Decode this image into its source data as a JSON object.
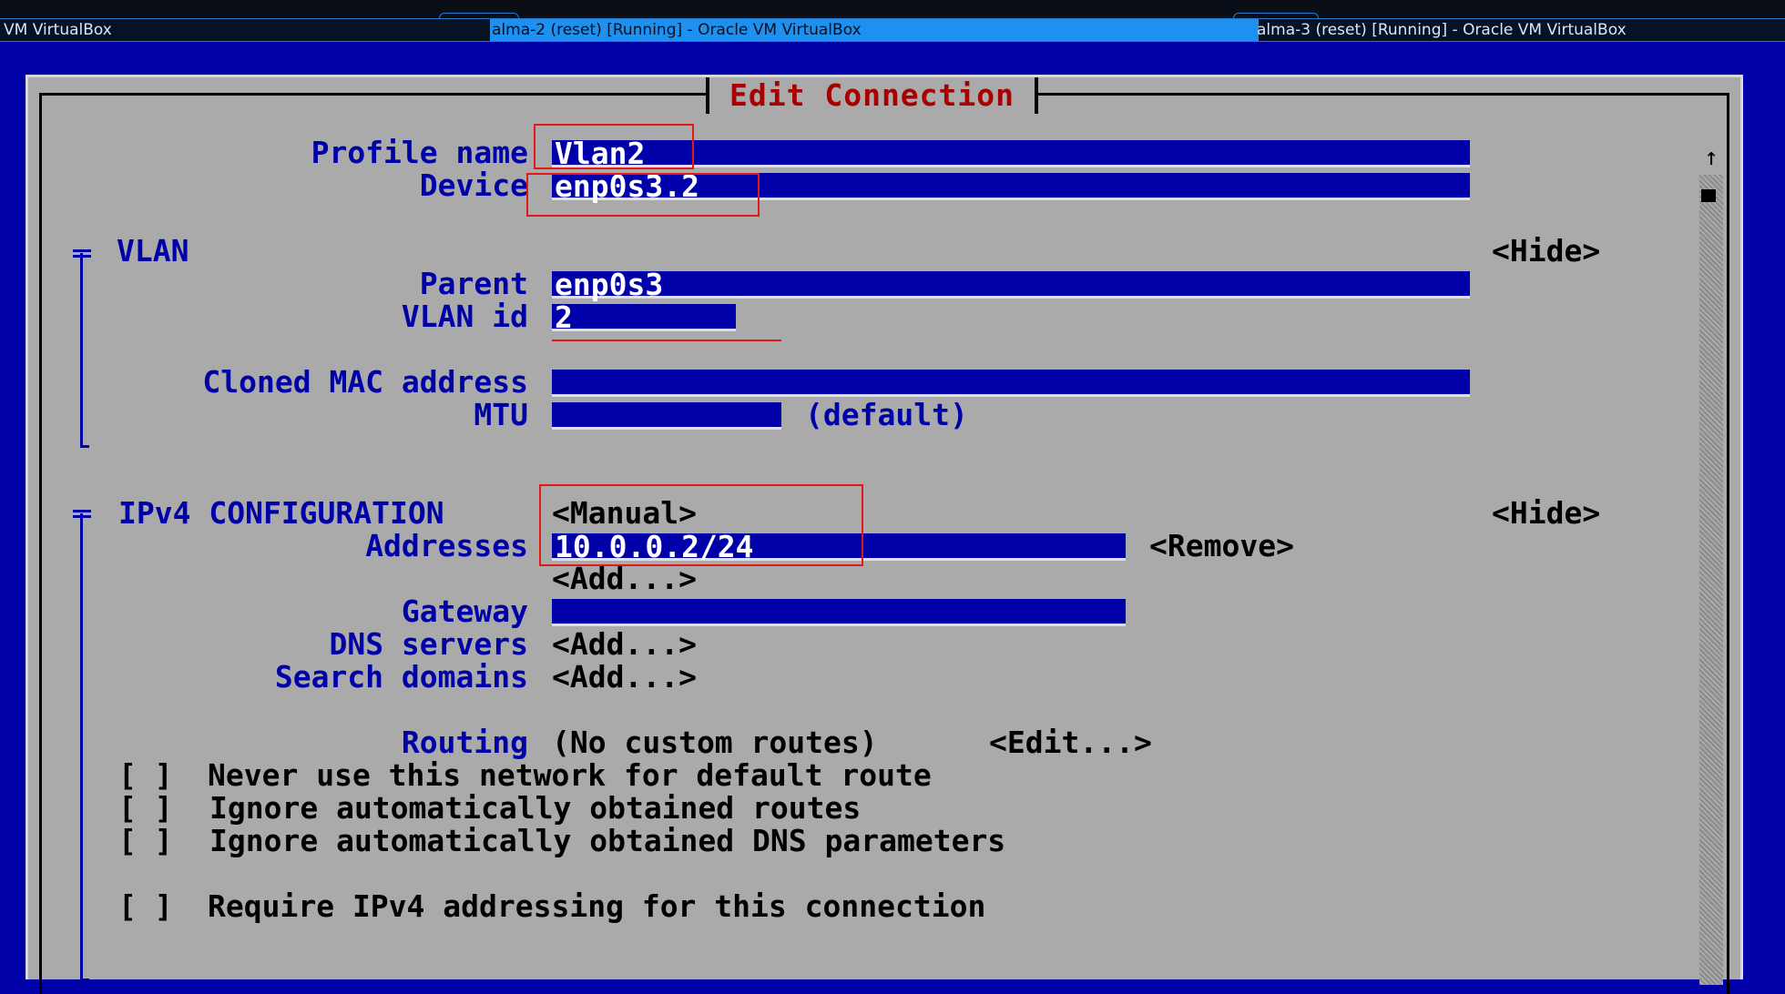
{
  "taskbar": {
    "tabs": [
      {
        "label": "VM VirtualBox"
      },
      {
        "label": "alma-2 (reset) [Running] - Oracle VM VirtualBox"
      },
      {
        "label": "alma-3 (reset) [Running] - Oracle VM VirtualBox"
      }
    ]
  },
  "dialog": {
    "title": "Edit Connection"
  },
  "profile": {
    "name_label": "Profile name",
    "name_value": "Vlan2",
    "device_label": "Device",
    "device_value": "enp0s3.2"
  },
  "vlan": {
    "section_label": "VLAN",
    "hide_label": "<Hide>",
    "parent_label": "Parent",
    "parent_value": "enp0s3",
    "id_label": "VLAN id",
    "id_value": "2",
    "mac_label": "Cloned MAC address",
    "mac_value": "",
    "mtu_label": "MTU",
    "mtu_value": "",
    "mtu_hint": "(default)"
  },
  "ipv4": {
    "section_label": "IPv4 CONFIGURATION",
    "method": "<Manual>",
    "hide_label": "<Hide>",
    "addresses_label": "Addresses",
    "address_value": "10.0.0.2/24",
    "remove_label": "<Remove>",
    "add_address_label": "<Add...>",
    "gateway_label": "Gateway",
    "gateway_value": "",
    "dns_label": "DNS servers",
    "dns_add_label": "<Add...>",
    "search_label": "Search domains",
    "search_add_label": "<Add...>",
    "routing_label": "Routing",
    "routing_value": "(No custom routes)",
    "routing_edit_label": "<Edit...>",
    "checkboxes": [
      {
        "mark": "[ ]",
        "label": "Never use this network for default route"
      },
      {
        "mark": "[ ]",
        "label": "Ignore automatically obtained routes"
      },
      {
        "mark": "[ ]",
        "label": "Ignore automatically obtained DNS parameters"
      },
      {
        "mark": "[ ]",
        "label": "Require IPv4 addressing for this connection"
      }
    ]
  },
  "scrollbar": {
    "up_arrow": "↑"
  }
}
